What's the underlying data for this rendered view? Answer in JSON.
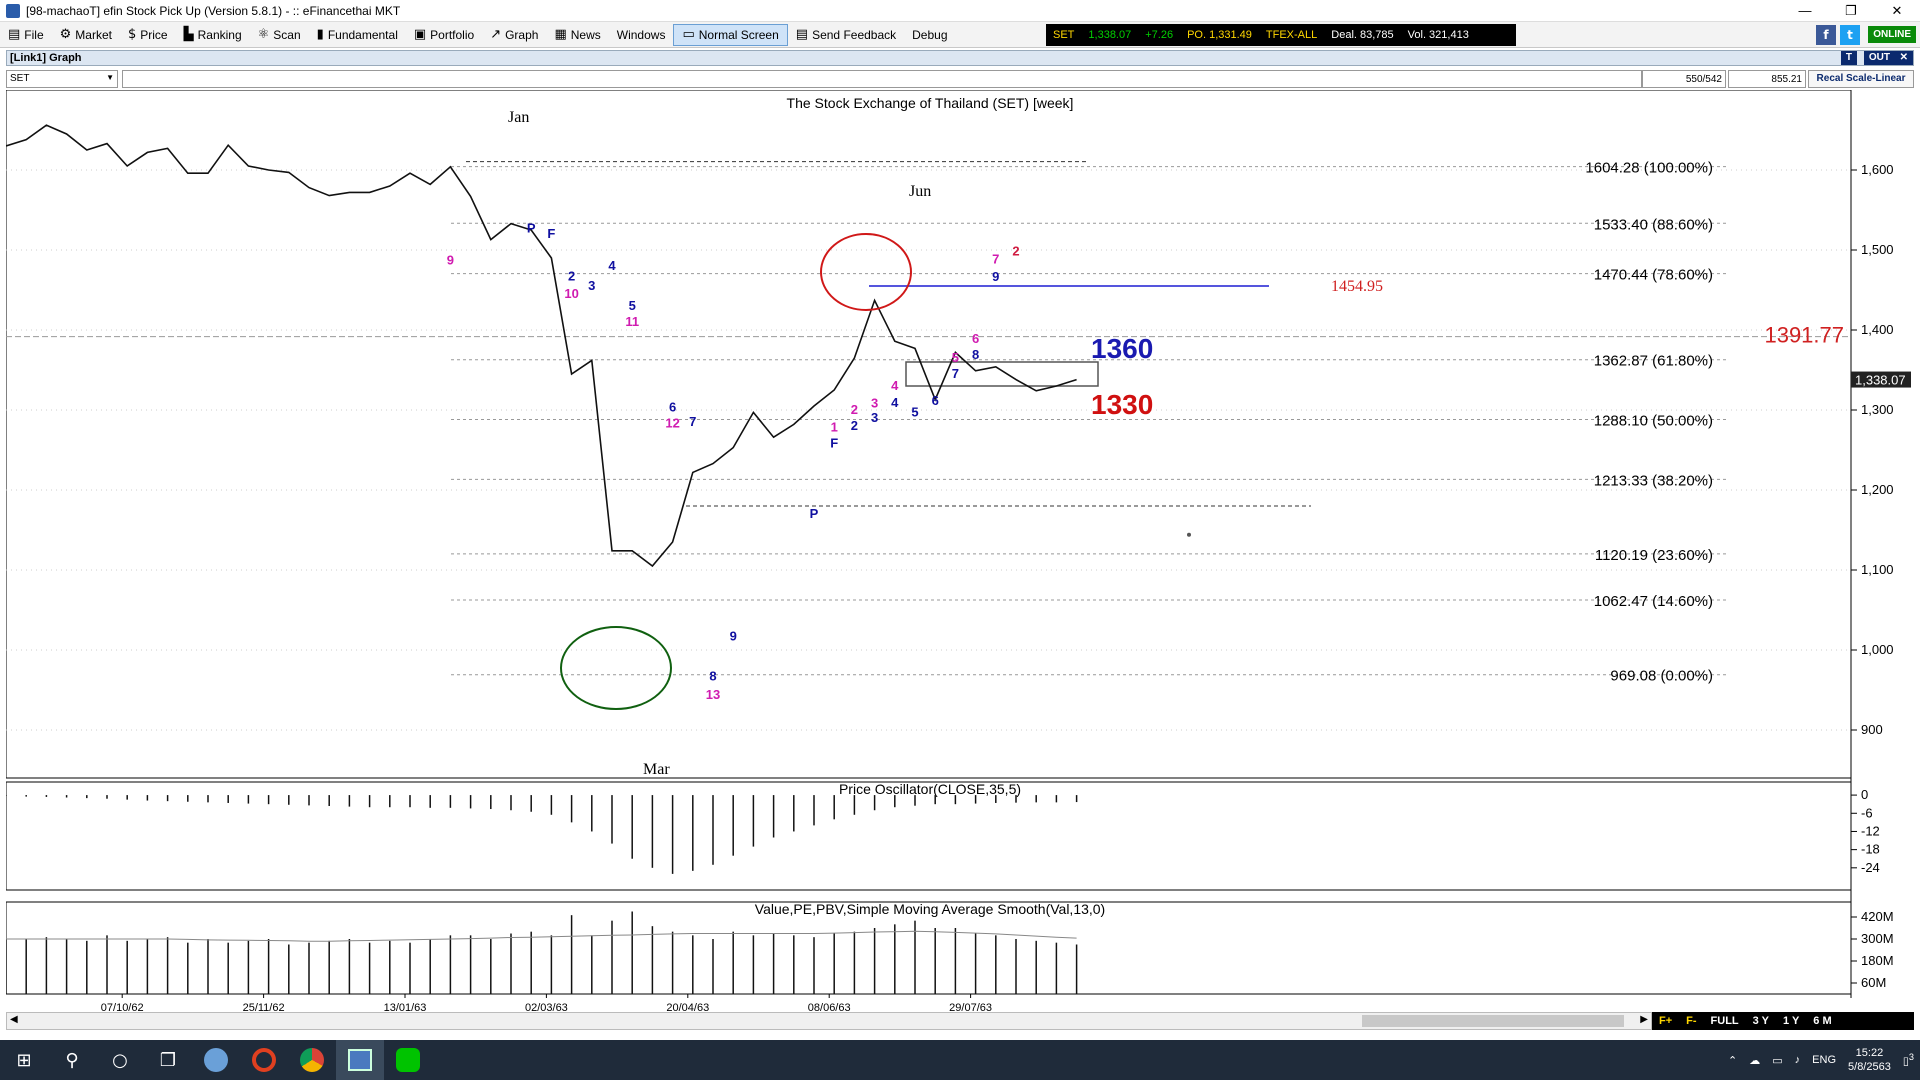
{
  "window": {
    "title": "[98-machaoT] efin Stock Pick Up (Version 5.8.1) - :: eFinancethai MKT",
    "min": "—",
    "max": "❐",
    "close": "✕"
  },
  "menu": [
    {
      "label": "File",
      "icon": "▤"
    },
    {
      "label": "Market",
      "icon": "⚙"
    },
    {
      "label": "Price",
      "icon": "$"
    },
    {
      "label": "Ranking",
      "icon": "▙"
    },
    {
      "label": "Scan",
      "icon": "⚛"
    },
    {
      "label": "Fundamental",
      "icon": "▮"
    },
    {
      "label": "Portfolio",
      "icon": "▣"
    },
    {
      "label": "Graph",
      "icon": "↗"
    },
    {
      "label": "News",
      "icon": "▦"
    },
    {
      "label": "Windows",
      "icon": ""
    },
    {
      "label": "Normal Screen",
      "icon": "▭"
    },
    {
      "label": "Send Feedback",
      "icon": "▤"
    },
    {
      "label": "Debug",
      "icon": ""
    }
  ],
  "ticker": {
    "index": "SET",
    "last": "1,338.07",
    "change": "+7.26",
    "po": "PO. 1,331.49",
    "tfex": "TFEX-ALL",
    "deal": "Deal. 83,785",
    "vol": "Vol. 321,413"
  },
  "status": {
    "online": "ONLINE"
  },
  "panel": {
    "title": "[Link1] Graph",
    "btn_t": "T",
    "btn_out": "OUT",
    "btn_close": "✕"
  },
  "toolbar": {
    "symbol": "SET",
    "box1": "550/542",
    "box2": "855.21",
    "recal": "Recal Scale-Linear"
  },
  "chart_data": {
    "type": "line",
    "title": "The Stock Exchange of Thailand (SET) [week]",
    "x": [
      "07/10/62",
      "25/11/62",
      "13/01/63",
      "02/03/63",
      "20/04/63",
      "08/06/63",
      "29/07/63"
    ],
    "series": [
      {
        "values": [
          1630,
          1638,
          1656,
          1645,
          1625,
          1633,
          1605,
          1622,
          1627,
          1596,
          1596,
          1631,
          1605,
          1600,
          1597,
          1578,
          1568,
          1572,
          1572,
          1580,
          1596,
          1582,
          1604,
          1567,
          1513,
          1533,
          1525,
          1490,
          1345,
          1362,
          1124,
          1124,
          1105,
          1135,
          1222,
          1233,
          1253,
          1297,
          1266,
          1282,
          1305,
          1325,
          1365,
          1437,
          1386,
          1377,
          1313,
          1372,
          1349,
          1354,
          1338,
          1324,
          1330,
          1338
        ]
      }
    ],
    "ylim": [
      840,
      1700
    ],
    "yticks": [
      "1,600",
      "1,500",
      "1,400",
      "1,300",
      "1,200",
      "1,100",
      "1,000",
      "900"
    ],
    "current_price": "1,338.07",
    "fibonacci": [
      {
        "value": 1604.28,
        "label": "1604.28 (100.00%)"
      },
      {
        "value": 1533.4,
        "label": "1533.40 (88.60%)"
      },
      {
        "value": 1470.44,
        "label": "1470.44 (78.60%)"
      },
      {
        "value": 1362.87,
        "label": "1362.87 (61.80%)"
      },
      {
        "value": 1288.1,
        "label": "1288.10 (50.00%)"
      },
      {
        "value": 1213.33,
        "label": "1213.33 (38.20%)"
      },
      {
        "value": 1120.19,
        "label": "1120.19 (23.60%)"
      },
      {
        "value": 1062.47,
        "label": "1062.47 (14.60%)"
      },
      {
        "value": 969.08,
        "label": "969.08 (0.00%)"
      }
    ],
    "annotations": {
      "month_jan": "Jan",
      "month_jun": "Jun",
      "month_mar": "Mar",
      "level_1454": "1454.95",
      "level_1391": "1391.77",
      "box_top": "1360",
      "box_bottom": "1330"
    },
    "td_counts": [
      {
        "t": "9",
        "c": "#d01bb0",
        "x": 22,
        "v": 1482
      },
      {
        "t": "P",
        "c": "#1010a0",
        "x": 26,
        "v": 1522
      },
      {
        "t": "F",
        "c": "#1010a0",
        "x": 27,
        "v": 1515
      },
      {
        "t": "2",
        "c": "#1010a0",
        "x": 28,
        "v": 1462
      },
      {
        "t": "10",
        "c": "#d01bb0",
        "x": 28,
        "v": 1440
      },
      {
        "t": "3",
        "c": "#1010a0",
        "x": 29,
        "v": 1450
      },
      {
        "t": "4",
        "c": "#1010a0",
        "x": 30,
        "v": 1475
      },
      {
        "t": "5",
        "c": "#1010a0",
        "x": 31,
        "v": 1425
      },
      {
        "t": "11",
        "c": "#d01bb0",
        "x": 31,
        "v": 1405
      },
      {
        "t": "6",
        "c": "#1010a0",
        "x": 33,
        "v": 1298
      },
      {
        "t": "12",
        "c": "#d01bb0",
        "x": 33,
        "v": 1278
      },
      {
        "t": "7",
        "c": "#1010a0",
        "x": 34,
        "v": 1280
      },
      {
        "t": "P",
        "c": "#1010a0",
        "x": 40,
        "v": 1165
      },
      {
        "t": "1",
        "c": "#d01bb0",
        "x": 41,
        "v": 1273
      },
      {
        "t": "F",
        "c": "#1010a0",
        "x": 41,
        "v": 1253
      },
      {
        "t": "2",
        "c": "#d01bb0",
        "x": 42,
        "v": 1295
      },
      {
        "t": "2",
        "c": "#1010a0",
        "x": 42,
        "v": 1275
      },
      {
        "t": "3",
        "c": "#d01bb0",
        "x": 43,
        "v": 1303
      },
      {
        "t": "3",
        "c": "#1010a0",
        "x": 43,
        "v": 1285
      },
      {
        "t": "4",
        "c": "#d01bb0",
        "x": 44,
        "v": 1325
      },
      {
        "t": "4",
        "c": "#1010a0",
        "x": 44,
        "v": 1304
      },
      {
        "t": "5",
        "c": "#1010a0",
        "x": 45,
        "v": 1292
      },
      {
        "t": "6",
        "c": "#1010a0",
        "x": 46,
        "v": 1306
      },
      {
        "t": "5",
        "c": "#d01bb0",
        "x": 47,
        "v": 1360
      },
      {
        "t": "7",
        "c": "#1010a0",
        "x": 47,
        "v": 1340
      },
      {
        "t": "6",
        "c": "#d01bb0",
        "x": 48,
        "v": 1384
      },
      {
        "t": "8",
        "c": "#1010a0",
        "x": 48,
        "v": 1364
      },
      {
        "t": "7",
        "c": "#d01bb0",
        "x": 49,
        "v": 1483
      },
      {
        "t": "9",
        "c": "#1010a0",
        "x": 49,
        "v": 1461
      },
      {
        "t": "2",
        "c": "#d01b40",
        "x": 50,
        "v": 1493
      },
      {
        "t": "9",
        "c": "#1010a0",
        "x": 36,
        "v": 1012
      },
      {
        "t": "8",
        "c": "#1010a0",
        "x": 35,
        "v": 962
      },
      {
        "t": "13",
        "c": "#d01bb0",
        "x": 35,
        "v": 939
      }
    ],
    "oscillator": {
      "label": "Price Oscillator(CLOSE,35,5)",
      "yticks": [
        "0",
        "-6",
        "-12",
        "-18",
        "-24"
      ],
      "ylim": [
        -30,
        3
      ],
      "values": [
        -0.3,
        -0.5,
        -0.6,
        -0.8,
        -1,
        -1.2,
        -1.5,
        -1.8,
        -2,
        -2.2,
        -2.4,
        -2.6,
        -2.8,
        -3,
        -3.2,
        -3.4,
        -3.6,
        -3.8,
        -4,
        -4,
        -4,
        -4.2,
        -4.2,
        -4.4,
        -4.6,
        -5,
        -5.5,
        -6.5,
        -9,
        -12,
        -16,
        -21,
        -24,
        -26,
        -25,
        -23,
        -20,
        -17,
        -14,
        -12,
        -10,
        -8,
        -6.5,
        -5,
        -4,
        -3.5,
        -3,
        -3,
        -2.8,
        -2.6,
        -2.5,
        -2.4,
        -2.4,
        -2.3
      ]
    },
    "volume": {
      "label": "Value,PE,PBV,Simple Moving Average Smooth(Val,13,0)",
      "yticks": [
        "420M",
        "300M",
        "180M",
        "60M"
      ],
      "ylim": [
        0,
        480
      ],
      "values": [
        300,
        300,
        310,
        300,
        290,
        320,
        290,
        300,
        310,
        280,
        300,
        280,
        290,
        300,
        270,
        280,
        290,
        300,
        280,
        290,
        280,
        300,
        320,
        320,
        300,
        330,
        340,
        320,
        430,
        320,
        400,
        450,
        370,
        340,
        320,
        300,
        340,
        320,
        330,
        320,
        310,
        330,
        340,
        360,
        380,
        400,
        360,
        360,
        330,
        320,
        300,
        290,
        280,
        270
      ],
      "sma": [
        300,
        300,
        300,
        300,
        300,
        300,
        300,
        300,
        300,
        298,
        295,
        294,
        293,
        292,
        290,
        288,
        288,
        290,
        292,
        294,
        296,
        298,
        300,
        302,
        305,
        308,
        310,
        312,
        315,
        318,
        320,
        322,
        325,
        328,
        330,
        330,
        330,
        330,
        330,
        330,
        330,
        332,
        335,
        338,
        340,
        342,
        340,
        336,
        332,
        328,
        322,
        316,
        310,
        305
      ]
    }
  },
  "zoom": {
    "f1": "F+",
    "f2": "F-",
    "full": "FULL",
    "y3": "3 Y",
    "y1": "1 Y",
    "m6": "6 M"
  },
  "scroll": {
    "left": "◀",
    "right": "▶"
  },
  "taskbar": {
    "start": "⊞",
    "search": "⚲",
    "cortana": "○",
    "taskview": "❐",
    "lang": "ENG",
    "time": "15:22",
    "date": "5/8/2563",
    "notif": "3"
  }
}
